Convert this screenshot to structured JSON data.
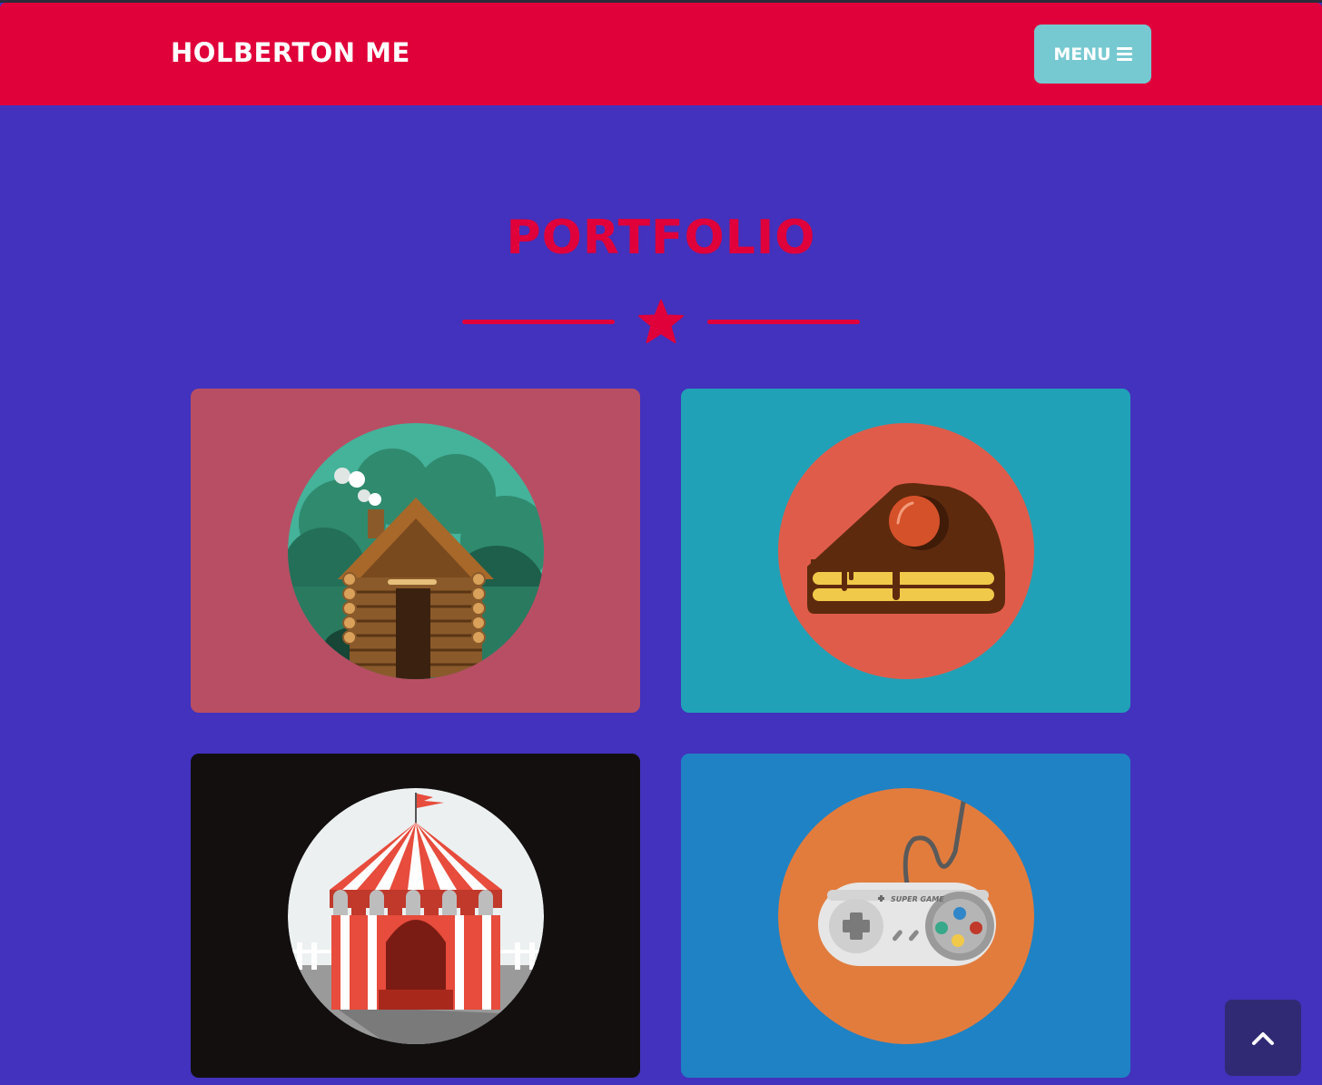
{
  "navbar": {
    "brand": "HOLBERTON ME",
    "menu_label": "MENU",
    "menu_icon": "bars-icon"
  },
  "portfolio": {
    "title": "PORTFOLIO",
    "divider_icon": "star-icon",
    "items": [
      {
        "name": "cabin",
        "icon": "log-cabin-icon",
        "bg": "#b84e64",
        "circle": "#45b29a"
      },
      {
        "name": "cake",
        "icon": "cake-slice-icon",
        "bg": "#21a1b7",
        "circle": "#e05c4a"
      },
      {
        "name": "circus",
        "icon": "circus-tent-icon",
        "bg": "#130f0f",
        "circle": "#ecf0f1"
      },
      {
        "name": "game",
        "icon": "game-controller-icon",
        "bg": "#1f82c4",
        "circle": "#e27c3d"
      }
    ],
    "controller_text": "SUPER GAME"
  },
  "scroll_top_icon": "chevron-up-icon",
  "colors": {
    "background": "#4232bd",
    "accent": "#e0003a",
    "menu_button": "#77c9d1",
    "scroll_top": "#302a74"
  }
}
